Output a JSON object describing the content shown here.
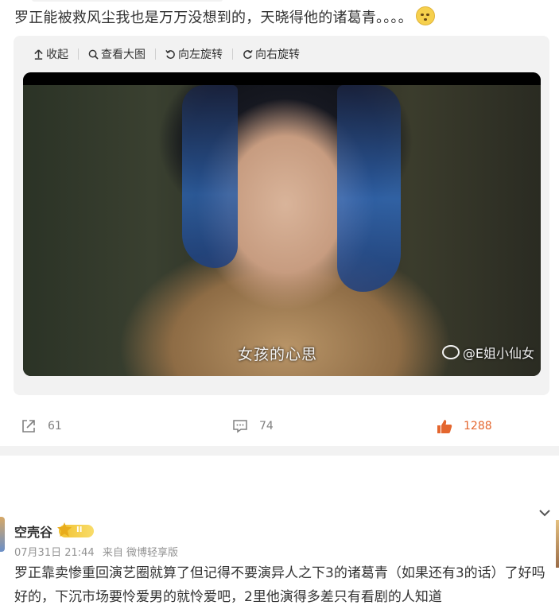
{
  "post": {
    "text": "罗正能被救风尘我也是万万没想到的，天晓得他的诸葛青。。。。"
  },
  "media_toolbar": {
    "collapse": "收起",
    "view_large": "查看大图",
    "rotate_left": "向左旋转",
    "rotate_right": "向右旋转"
  },
  "video": {
    "subtitle": "女孩的心思",
    "watermark": "@E姐小仙女"
  },
  "actions": {
    "reposts": "61",
    "comments": "74",
    "likes": "1288",
    "like_color": "#e4662e"
  },
  "comment": {
    "user_name": "空壳谷",
    "vip_level": "II",
    "date": "07月31日 21:44",
    "source": "来自 微博轻享版",
    "text": "罗正靠卖惨重回演艺圈就算了但记得不要演异人之下3的诸葛青（如果还有3的话）了好吗好的，下沉市场要怜爱男的就怜爱吧，2里他演得多差只有看剧的人知道"
  },
  "icons": {
    "collapse": "arrow-up-icon",
    "view_large": "magnifier-icon",
    "rotate_left": "rotate-left-icon",
    "rotate_right": "rotate-right-icon",
    "repost": "share-icon",
    "comment": "comment-icon",
    "like": "thumb-up-icon",
    "expand": "chevron-down-icon"
  }
}
